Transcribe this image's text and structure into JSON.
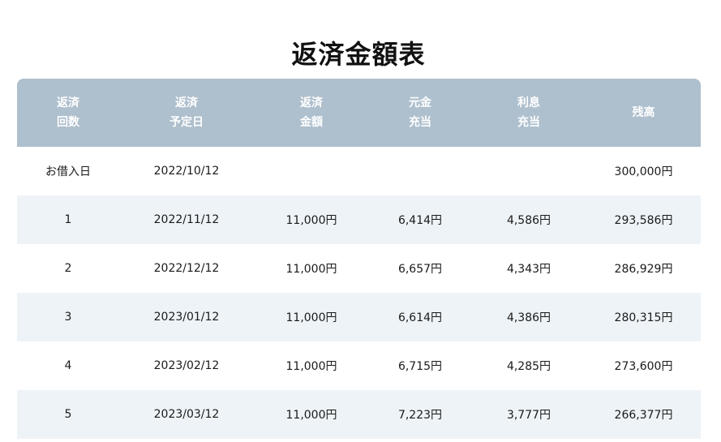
{
  "title": "返済金額表",
  "headers": [
    {
      "line1": "返済",
      "line2": "回数"
    },
    {
      "line1": "返済",
      "line2": "予定日"
    },
    {
      "line1": "返済",
      "line2": "金額"
    },
    {
      "line1": "元金",
      "line2": "充当"
    },
    {
      "line1": "利息",
      "line2": "充当"
    },
    {
      "line1": "残高",
      "line2": ""
    }
  ],
  "rows": [
    {
      "count": "お借入日",
      "date": "2022/10/12",
      "amount": "",
      "principal": "",
      "interest": "",
      "balance": "300,000円"
    },
    {
      "count": "1",
      "date": "2022/11/12",
      "amount": "11,000円",
      "principal": "6,414円",
      "interest": "4,586円",
      "balance": "293,586円"
    },
    {
      "count": "2",
      "date": "2022/12/12",
      "amount": "11,000円",
      "principal": "6,657円",
      "interest": "4,343円",
      "balance": "286,929円"
    },
    {
      "count": "3",
      "date": "2023/01/12",
      "amount": "11,000円",
      "principal": "6,614円",
      "interest": "4,386円",
      "balance": "280,315円"
    },
    {
      "count": "4",
      "date": "2023/02/12",
      "amount": "11,000円",
      "principal": "6,715円",
      "interest": "4,285円",
      "balance": "273,600円"
    },
    {
      "count": "5",
      "date": "2023/03/12",
      "amount": "11,000円",
      "principal": "7,223円",
      "interest": "3,777円",
      "balance": "266,377円"
    }
  ],
  "colors": {
    "header_bg": "#aebfcd",
    "header_text": "#ffffff",
    "row_alt_bg": "#eef3f7",
    "row_bg": "#ffffff"
  }
}
